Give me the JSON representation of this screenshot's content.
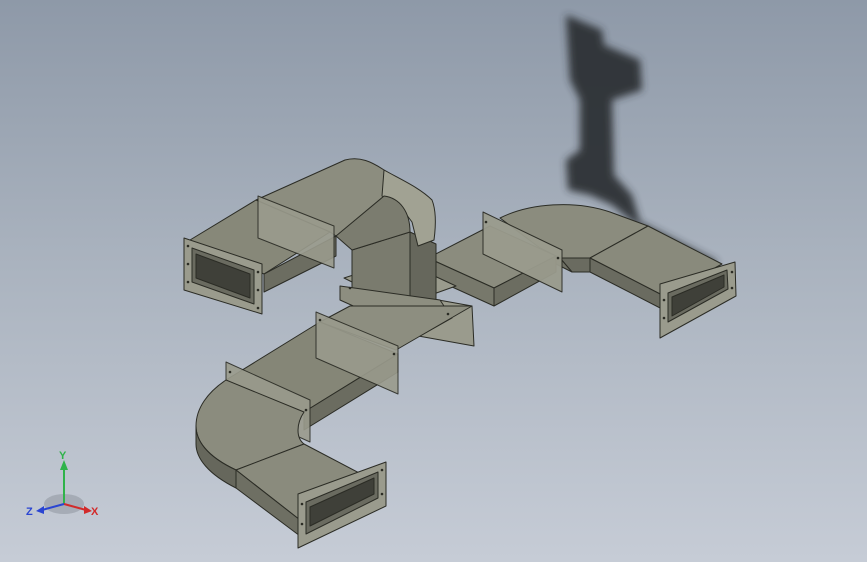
{
  "viewport": {
    "background_top": "#8e99a8",
    "background_bottom": "#c6ccd6"
  },
  "model": {
    "duct_face_top": "#8b8c7e",
    "duct_face_side": "#6f7064",
    "flange_color": "#9a9b8d",
    "edge_color": "#2b2c25",
    "shadow_color": "#2a2d31"
  },
  "triad": {
    "x_label": "X",
    "y_label": "Y",
    "z_label": "Z",
    "x_color": "#d22a2a",
    "y_color": "#2fb34a",
    "z_color": "#2a45d2"
  }
}
